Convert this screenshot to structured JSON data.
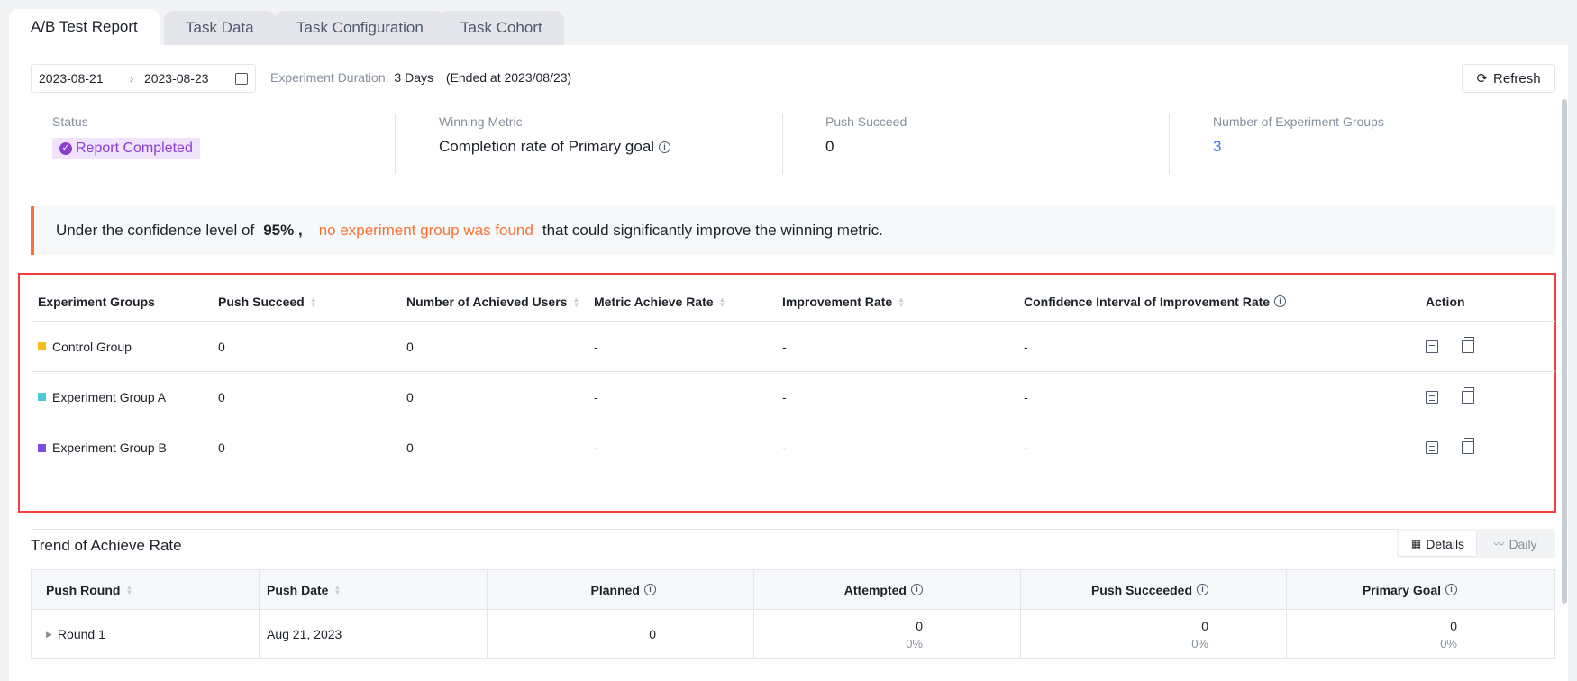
{
  "tabs": [
    "A/B Test Report",
    "Task Data",
    "Task Configuration",
    "Task Cohort"
  ],
  "date_range": {
    "start": "2023-08-21",
    "separator": "›",
    "end": "2023-08-23"
  },
  "duration": {
    "label": "Experiment Duration:",
    "value": "3 Days",
    "ended": "(Ended at 2023/08/23)"
  },
  "refresh_label": "Refresh",
  "stats": {
    "status": {
      "label": "Status",
      "value": "Report Completed"
    },
    "winning_metric": {
      "label": "Winning Metric",
      "value": "Completion rate of Primary goal"
    },
    "push_succeed": {
      "label": "Push Succeed",
      "value": "0"
    },
    "groups": {
      "label": "Number of Experiment Groups",
      "value": "3"
    }
  },
  "alert": {
    "prefix": "Under the confidence level of",
    "level": "95% ,",
    "highlight": "no experiment group was found",
    "suffix": "that could significantly improve the winning metric."
  },
  "group_table": {
    "headers": [
      "Experiment Groups",
      "Push Succeed",
      "Number of Achieved Users",
      "Metric Achieve Rate",
      "Improvement Rate",
      "Confidence Interval of Improvement Rate",
      "Action"
    ],
    "rows": [
      {
        "name": "Control Group",
        "color": "#f7ba1e",
        "push": "0",
        "achieved": "0",
        "rate": "-",
        "improvement": "-",
        "ci": "-"
      },
      {
        "name": "Experiment Group A",
        "color": "#4cc9d6",
        "push": "0",
        "achieved": "0",
        "rate": "-",
        "improvement": "-",
        "ci": "-"
      },
      {
        "name": "Experiment Group B",
        "color": "#7b4ce8",
        "push": "0",
        "achieved": "0",
        "rate": "-",
        "improvement": "-",
        "ci": "-"
      }
    ]
  },
  "trend": {
    "title": "Trend of Achieve Rate",
    "views": [
      "Details",
      "Daily"
    ],
    "headers": [
      "Push Round",
      "Push Date",
      "Planned",
      "Attempted",
      "Push Succeeded",
      "Primary Goal"
    ],
    "rows": [
      {
        "round": "Round 1",
        "date": "Aug 21, 2023",
        "planned": "0",
        "attempted": "0",
        "attempted_pct": "0%",
        "succeeded": "0",
        "succeeded_pct": "0%",
        "goal": "0",
        "goal_pct": "0%"
      }
    ]
  }
}
